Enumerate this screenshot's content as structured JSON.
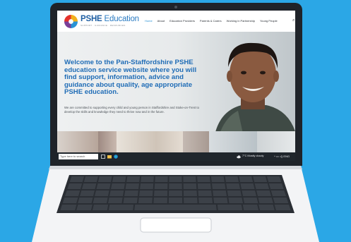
{
  "site": {
    "brand_bold": "PSHE",
    "brand_light": " Education",
    "tagline": "SUPPORT · GUIDANCE · RESOURCES"
  },
  "nav": {
    "items": [
      "Home",
      "About",
      "Education Providers",
      "Parents & Carers",
      "Working in Partnership",
      "Young People"
    ],
    "active": "Home",
    "search_icon": "⌕"
  },
  "hero": {
    "title": "Welcome to the Pan-Staffordshire PSHE education service website where you will find support, information, advice and guidance about quality, age appropriate PSHE education.",
    "text": "We are committed to supporting every child and young person in Staffordshire and Stoke-on-Trent to develop the skills and knowledge they need to thrive now and in the future."
  },
  "taskbar": {
    "search_placeholder": "Type here to search",
    "weather": "7°C  Mostly cloudy",
    "tray": "^  ▭  ◁)  ENG"
  },
  "colors": {
    "background": "#2ba7e6",
    "brand_blue": "#1f6cb6",
    "nav_active": "#2a93d5"
  }
}
